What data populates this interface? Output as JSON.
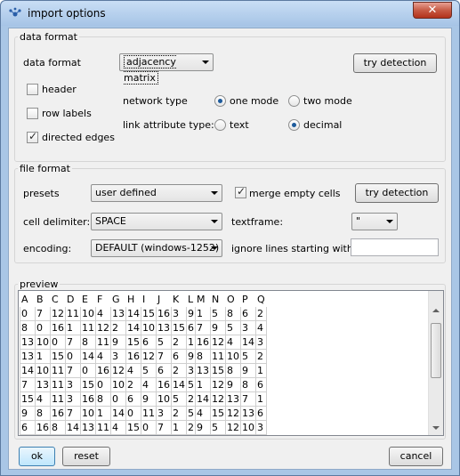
{
  "window": {
    "title": "import options",
    "close_glyph": "✕"
  },
  "data_format": {
    "group_label": "data format",
    "label": "data format",
    "value": "adjacency matrix",
    "try_detection": "try detection",
    "header": {
      "label": "header",
      "checked": false
    },
    "row_labels": {
      "label": "row labels",
      "checked": false
    },
    "directed_edges": {
      "label": "directed edges",
      "checked": true
    },
    "network_type_label": "network type",
    "one_mode": {
      "label": "one mode",
      "selected": true
    },
    "two_mode": {
      "label": "two mode",
      "selected": false
    },
    "link_attr_label": "link attribute type:",
    "text": {
      "label": "text",
      "selected": false
    },
    "decimal": {
      "label": "decimal",
      "selected": true
    }
  },
  "file_format": {
    "group_label": "file format",
    "presets_label": "presets",
    "presets_value": "user defined",
    "merge_empty": {
      "label": "merge empty cells",
      "checked": true
    },
    "try_detection": "try detection",
    "cell_delim_label": "cell delimiter:",
    "cell_delim_value": "SPACE",
    "textframe_label": "textframe:",
    "textframe_value": "\"",
    "encoding_label": "encoding:",
    "encoding_value": "DEFAULT (windows-1252)",
    "ignore_label": "ignore lines starting with:",
    "ignore_value": ""
  },
  "preview": {
    "group_label": "preview",
    "columns": [
      "A",
      "B",
      "C",
      "D",
      "E",
      "F",
      "G",
      "H",
      "I",
      "J",
      "K",
      "L",
      "M",
      "N",
      "O",
      "P",
      "Q"
    ],
    "rows": [
      [
        "0",
        "7",
        "12",
        "11",
        "10",
        "4",
        "13",
        "14",
        "15",
        "16",
        "3",
        "9",
        "1",
        "5",
        "8",
        "6",
        "2"
      ],
      [
        "8",
        "0",
        "16",
        "1",
        "11",
        "12",
        "2",
        "14",
        "10",
        "13",
        "15",
        "6",
        "7",
        "9",
        "5",
        "3",
        "4"
      ],
      [
        "13",
        "10",
        "0",
        "7",
        "8",
        "11",
        "9",
        "15",
        "6",
        "5",
        "2",
        "1",
        "16",
        "12",
        "4",
        "14",
        "3"
      ],
      [
        "13",
        "1",
        "15",
        "0",
        "14",
        "4",
        "3",
        "16",
        "12",
        "7",
        "6",
        "9",
        "8",
        "11",
        "10",
        "5",
        "2"
      ],
      [
        "14",
        "10",
        "11",
        "7",
        "0",
        "16",
        "12",
        "4",
        "5",
        "6",
        "2",
        "3",
        "13",
        "15",
        "8",
        "9",
        "1"
      ],
      [
        "7",
        "13",
        "11",
        "3",
        "15",
        "0",
        "10",
        "2",
        "4",
        "16",
        "14",
        "5",
        "1",
        "12",
        "9",
        "8",
        "6"
      ],
      [
        "15",
        "4",
        "11",
        "3",
        "16",
        "8",
        "0",
        "6",
        "9",
        "10",
        "5",
        "2",
        "14",
        "12",
        "13",
        "7",
        "1"
      ],
      [
        "9",
        "8",
        "16",
        "7",
        "10",
        "1",
        "14",
        "0",
        "11",
        "3",
        "2",
        "5",
        "4",
        "15",
        "12",
        "13",
        "6"
      ],
      [
        "6",
        "16",
        "8",
        "14",
        "13",
        "11",
        "4",
        "15",
        "0",
        "7",
        "1",
        "2",
        "9",
        "5",
        "12",
        "10",
        "3"
      ]
    ]
  },
  "buttons": {
    "ok": "ok",
    "reset": "reset",
    "cancel": "cancel"
  }
}
